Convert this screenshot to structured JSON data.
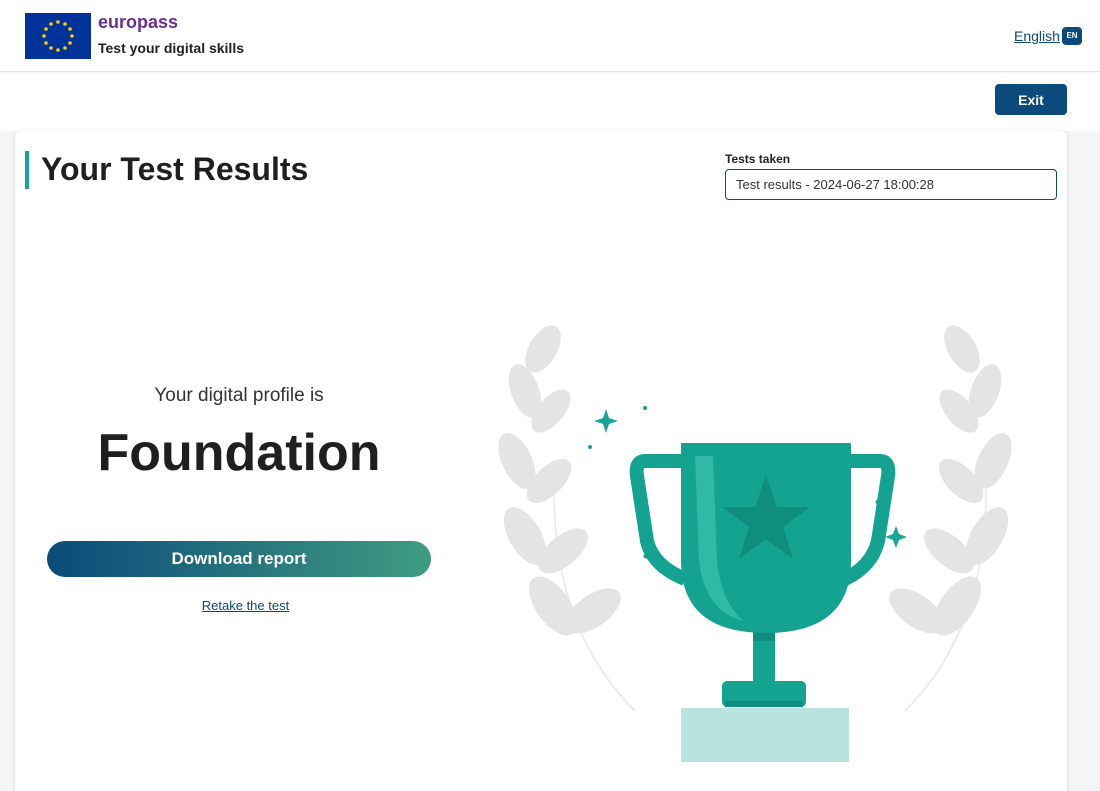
{
  "header": {
    "brand_name": "europass",
    "brand_subtitle": "Test your digital skills",
    "language_label": "English",
    "language_code": "EN"
  },
  "toolbar": {
    "exit_label": "Exit"
  },
  "results": {
    "title": "Your Test Results",
    "tests_taken_label": "Tests taken",
    "tests_taken_value": "Test results - 2024-06-27 18:00:28",
    "profile_intro": "Your digital profile is",
    "profile_level": "Foundation",
    "download_label": "Download report",
    "retake_label": "Retake the test"
  },
  "colors": {
    "brand_purple": "#6b2f8e",
    "primary_blue": "#0b4a7a",
    "accent_teal": "#17a597"
  },
  "icons": {
    "flag": "eu-flag-icon",
    "language": "language-badge-icon",
    "illustration": "trophy-icon"
  }
}
